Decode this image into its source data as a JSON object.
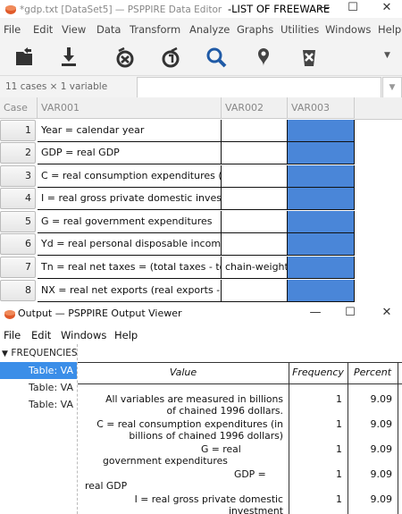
{
  "editor": {
    "title_prefix": "*gdp.txt [DataSet5] — PSPPIRE Data Editor",
    "title_overlay": "-LIST OF FREEWARE",
    "menu": [
      "File",
      "Edit",
      "View",
      "Data",
      "Transform",
      "Analyze",
      "Graphs",
      "Utilities",
      "Windows",
      "Help"
    ],
    "case_info": "11 cases × 1 variable",
    "columns": [
      "Case",
      "VAR001",
      "VAR002",
      "VAR003"
    ],
    "rows": [
      {
        "case": "1",
        "var001": "Year = calendar year",
        "var002": ""
      },
      {
        "case": "2",
        "var001": "GDP = real GDP",
        "var002": ""
      },
      {
        "case": "3",
        "var001": "C = real consumption expenditures (in l",
        "var002": ""
      },
      {
        "case": "4",
        "var001": "I = real gross private domestic investm",
        "var002": ""
      },
      {
        "case": "5",
        "var001": "G = real government expenditures",
        "var002": ""
      },
      {
        "case": "6",
        "var001": "Yd = real personal disposable income",
        "var002": ""
      },
      {
        "case": "7",
        "var001": "Tn = real net taxes = (total taxes - tota",
        "var002": "chain-weight"
      },
      {
        "case": "8",
        "var001": "NX = real net exports (real exports - re",
        "var002": ""
      }
    ],
    "selection_color": "#4a86d8"
  },
  "output": {
    "title": "Output — PSPPIRE Output Viewer",
    "menu": [
      "File",
      "Edit",
      "Windows",
      "Help"
    ],
    "tree": {
      "root": "FREQUENCIES",
      "items": [
        "Table: VA",
        "Table: VA",
        "Table: VA"
      ]
    },
    "table": {
      "headers": [
        "Value",
        "Frequency",
        "Percent"
      ],
      "rows": [
        {
          "value": "All variables are measured in billions of chained 1996 dollars.",
          "freq": "1",
          "pct": "9.09"
        },
        {
          "value": "C = real consumption expenditures (in billions of chained 1996 dollars)",
          "freq": "1",
          "pct": "9.09"
        },
        {
          "value": "G = real government expenditures",
          "freq": "1",
          "pct": "9.09"
        },
        {
          "value": "GDP = real GDP",
          "freq": "1",
          "pct": "9.09"
        },
        {
          "value": "I = real gross private domestic investment",
          "freq": "1",
          "pct": "9.09"
        }
      ]
    }
  }
}
